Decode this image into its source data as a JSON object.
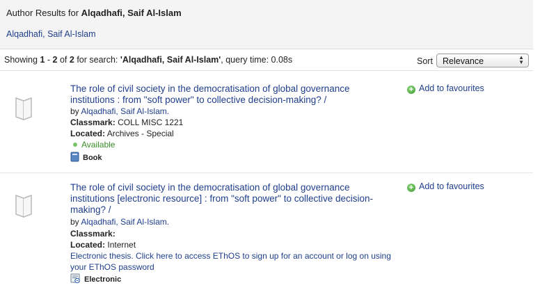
{
  "header": {
    "prefix": "Author Results for",
    "author": "Alqadhafi, Saif Al-Islam",
    "author_link": "Alqadhafi, Saif Al-Islam"
  },
  "results_bar": {
    "showing": "Showing",
    "start": "1",
    "dash": "-",
    "end": "2",
    "of": "of",
    "total": "2",
    "for_search": "for search:",
    "query": "'Alqadhafi, Saif Al-Islam'",
    "query_time": ", query time: 0.08s",
    "sort_label": "Sort",
    "sort_value": "Relevance"
  },
  "records": [
    {
      "title": "The role of civil society in the democratisation of global governance institutions : from \"soft power\" to collective decision-making? /",
      "by": "by",
      "author": "Alqadhafi, Saif Al-Islam.",
      "classmark_label": "Classmark:",
      "classmark": "COLL MISC 1221",
      "located_label": "Located:",
      "located": "Archives - Special",
      "status": "Available",
      "format": "Book",
      "favourite": "Add to favourites"
    },
    {
      "title": "The role of civil society in the democratisation of global governance institutions [electronic resource] : from \"soft power\" to collective decision-making? /",
      "by": "by",
      "author": "Alqadhafi, Saif Al-Islam.",
      "classmark_label": "Classmark:",
      "classmark": "",
      "located_label": "Located:",
      "located": "Internet",
      "note": "Electronic thesis. Click here to access EThOS to sign up for an account or log on using your EThOS password",
      "format": "Electronic",
      "favourite": "Add to favourites"
    }
  ],
  "icons": {
    "thumbnail": "book-placeholder-icon",
    "favourite": "plus-circle-icon",
    "available": "status-dot-icon",
    "book": "book-icon",
    "electronic": "electronic-resource-icon",
    "sort": "select-arrows-icon"
  },
  "colors": {
    "link": "#1f3e8c",
    "available": "#3a8d2a",
    "header_bg": "#f4f4f4"
  }
}
